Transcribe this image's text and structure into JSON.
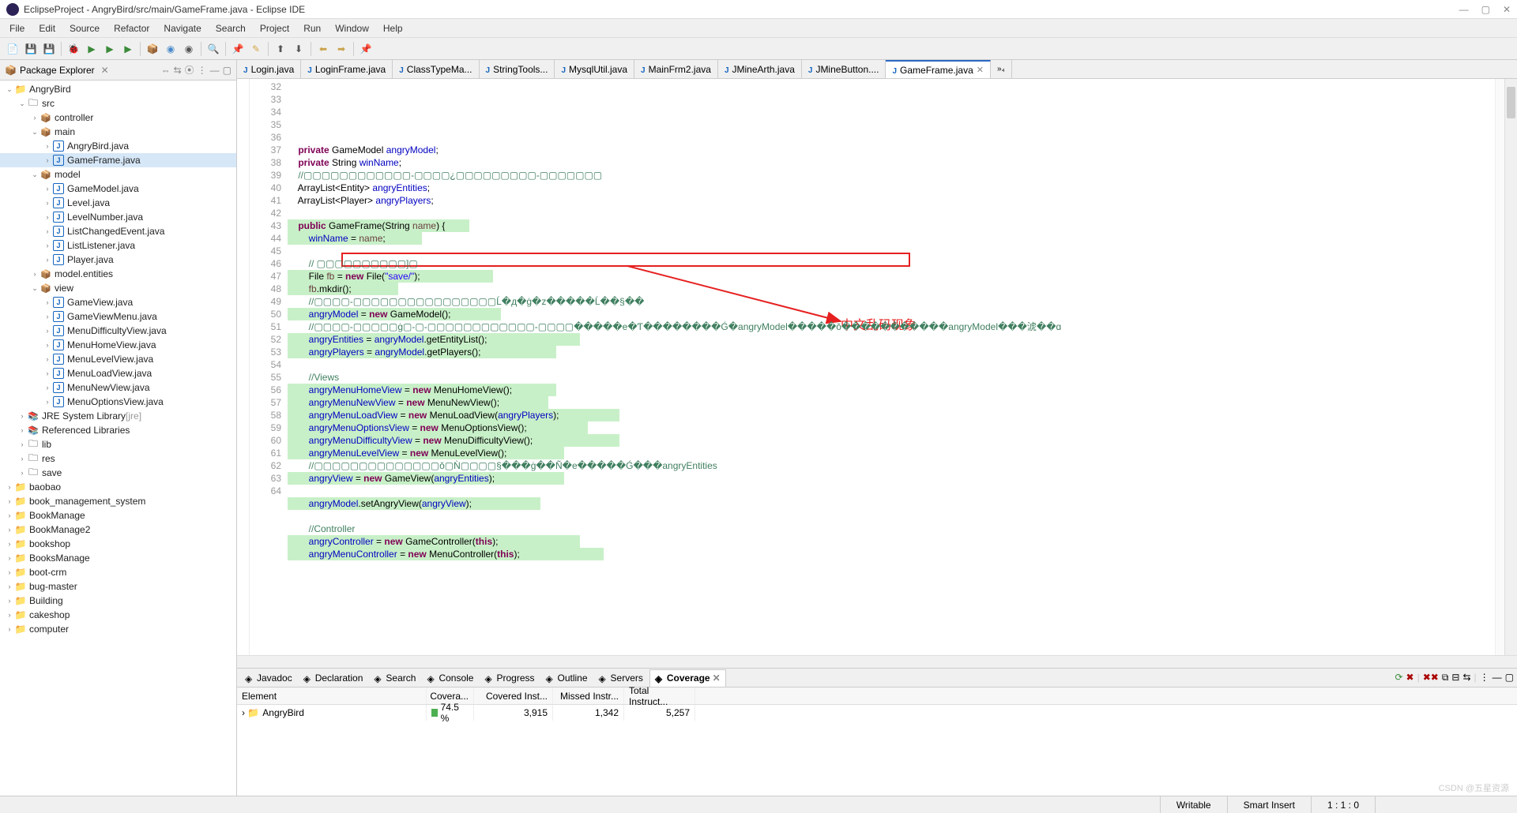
{
  "window": {
    "title": "EclipseProject - AngryBird/src/main/GameFrame.java - Eclipse IDE"
  },
  "menus": [
    "File",
    "Edit",
    "Source",
    "Refactor",
    "Navigate",
    "Search",
    "Project",
    "Run",
    "Window",
    "Help"
  ],
  "package_explorer": {
    "title": "Package Explorer",
    "tree": [
      {
        "d": 0,
        "t": "v",
        "ic": "proj",
        "l": "AngryBird"
      },
      {
        "d": 1,
        "t": "v",
        "ic": "fold",
        "l": "src"
      },
      {
        "d": 2,
        "t": ">",
        "ic": "pkg",
        "l": "controller"
      },
      {
        "d": 2,
        "t": "v",
        "ic": "pkg",
        "l": "main"
      },
      {
        "d": 3,
        "t": ">",
        "ic": "java",
        "l": "AngryBird.java"
      },
      {
        "d": 3,
        "t": ">",
        "ic": "java",
        "l": "GameFrame.java",
        "sel": true
      },
      {
        "d": 2,
        "t": "v",
        "ic": "pkg",
        "l": "model"
      },
      {
        "d": 3,
        "t": ">",
        "ic": "java",
        "l": "GameModel.java"
      },
      {
        "d": 3,
        "t": ">",
        "ic": "java",
        "l": "Level.java"
      },
      {
        "d": 3,
        "t": ">",
        "ic": "java",
        "l": "LevelNumber.java"
      },
      {
        "d": 3,
        "t": ">",
        "ic": "java",
        "l": "ListChangedEvent.java"
      },
      {
        "d": 3,
        "t": ">",
        "ic": "java",
        "l": "ListListener.java"
      },
      {
        "d": 3,
        "t": ">",
        "ic": "java",
        "l": "Player.java"
      },
      {
        "d": 2,
        "t": ">",
        "ic": "pkg",
        "l": "model.entities"
      },
      {
        "d": 2,
        "t": "v",
        "ic": "pkg",
        "l": "view"
      },
      {
        "d": 3,
        "t": ">",
        "ic": "java",
        "l": "GameView.java"
      },
      {
        "d": 3,
        "t": ">",
        "ic": "java",
        "l": "GameViewMenu.java"
      },
      {
        "d": 3,
        "t": ">",
        "ic": "java",
        "l": "MenuDifficultyView.java"
      },
      {
        "d": 3,
        "t": ">",
        "ic": "java",
        "l": "MenuHomeView.java"
      },
      {
        "d": 3,
        "t": ">",
        "ic": "java",
        "l": "MenuLevelView.java"
      },
      {
        "d": 3,
        "t": ">",
        "ic": "java",
        "l": "MenuLoadView.java"
      },
      {
        "d": 3,
        "t": ">",
        "ic": "java",
        "l": "MenuNewView.java"
      },
      {
        "d": 3,
        "t": ">",
        "ic": "java",
        "l": "MenuOptionsView.java"
      },
      {
        "d": 1,
        "t": ">",
        "ic": "lib",
        "l": "JRE System Library",
        "suffix": "[jre]"
      },
      {
        "d": 1,
        "t": ">",
        "ic": "lib",
        "l": "Referenced Libraries"
      },
      {
        "d": 1,
        "t": ">",
        "ic": "fold",
        "l": "lib"
      },
      {
        "d": 1,
        "t": ">",
        "ic": "fold",
        "l": "res"
      },
      {
        "d": 1,
        "t": ">",
        "ic": "fold",
        "l": "save"
      },
      {
        "d": 0,
        "t": ">",
        "ic": "proj",
        "l": "baobao"
      },
      {
        "d": 0,
        "t": ">",
        "ic": "proj",
        "l": "book_management_system"
      },
      {
        "d": 0,
        "t": ">",
        "ic": "proj",
        "l": "BookManage"
      },
      {
        "d": 0,
        "t": ">",
        "ic": "proj",
        "l": "BookManage2"
      },
      {
        "d": 0,
        "t": ">",
        "ic": "proj",
        "l": "bookshop"
      },
      {
        "d": 0,
        "t": ">",
        "ic": "proj",
        "l": "BooksManage"
      },
      {
        "d": 0,
        "t": ">",
        "ic": "proj",
        "l": "boot-crm"
      },
      {
        "d": 0,
        "t": ">",
        "ic": "proj",
        "l": "bug-master"
      },
      {
        "d": 0,
        "t": ">",
        "ic": "proj",
        "l": "Building"
      },
      {
        "d": 0,
        "t": ">",
        "ic": "proj",
        "l": "cakeshop"
      },
      {
        "d": 0,
        "t": ">",
        "ic": "proj",
        "l": "computer"
      }
    ]
  },
  "editor": {
    "tabs": [
      {
        "l": "Login.java"
      },
      {
        "l": "LoginFrame.java"
      },
      {
        "l": "ClassTypeMa..."
      },
      {
        "l": "StringTools..."
      },
      {
        "l": "MysqlUtil.java"
      },
      {
        "l": "MainFrm2.java"
      },
      {
        "l": "JMineArth.java"
      },
      {
        "l": "JMineButton...."
      },
      {
        "l": "GameFrame.java",
        "active": true
      }
    ],
    "first_line": 32,
    "lines": [
      {
        "hl": false,
        "html": "    <span class='kw'>private</span> GameModel <span class='fld'>angryModel</span>;"
      },
      {
        "hl": false,
        "html": "    <span class='kw'>private</span> String <span class='fld'>winName</span>;"
      },
      {
        "hl": false,
        "html": "    <span class='cmt'>//▢▢▢▢▢▢▢▢▢▢▢▢-▢▢▢▢¿▢▢▢▢▢▢▢▢▢-▢▢▢▢▢▢▢</span>"
      },
      {
        "hl": false,
        "html": "    ArrayList&lt;Entity&gt; <span class='fld'>angryEntities</span>;"
      },
      {
        "hl": false,
        "html": "    ArrayList&lt;Player&gt; <span class='fld'>angryPlayers</span>;"
      },
      {
        "hl": false,
        "html": ""
      },
      {
        "hl": true,
        "hlw": 230,
        "html": "    <span class='kw'>public</span> GameFrame(String <span class='var'>name</span>) {"
      },
      {
        "hl": true,
        "hlw": 170,
        "html": "        <span class='fld'>winName</span> = <span class='var'>name</span>;"
      },
      {
        "hl": false,
        "html": ""
      },
      {
        "hl": false,
        "html": "        <span class='cmt'>// ▢▢▢▢▢▢▢▢▢▢]▢</span>"
      },
      {
        "hl": true,
        "hlw": 260,
        "html": "        File <span class='var'>fb</span> = <span class='kw'>new</span> File(<span class='str'>\"save/\"</span>);"
      },
      {
        "hl": true,
        "hlw": 140,
        "html": "        <span class='var'>fb</span>.mkdir();"
      },
      {
        "hl": false,
        "html": "        <span class='cmt'>//▢▢▢▢-▢▢▢▢▢▢▢▢▢▢▢▢▢▢▢▢Ĺ�д�ġ�z�����Ĺ��§��</span>"
      },
      {
        "hl": true,
        "hlw": 270,
        "html": "        <span class='fld'>angryModel</span> = <span class='kw'>new</span> GameModel();"
      },
      {
        "hl": false,
        "html": "        <span class='cmt'>//▢▢▢▢-▢▢▢▢▢ġ▢-▢-▢▢▢▢▢▢▢▢▢▢▢▢-▢▢▢▢�����e�Ƭ��������Ǵ�angryModel�����ǒ�����������angryModel���淲��ɑ</span>"
      },
      {
        "hl": true,
        "hlw": 370,
        "html": "        <span class='fld'>angryEntities</span> = <span class='fld'>angryModel</span>.getEntityList();"
      },
      {
        "hl": true,
        "hlw": 340,
        "html": "        <span class='fld'>angryPlayers</span> = <span class='fld'>angryModel</span>.getPlayers();"
      },
      {
        "hl": false,
        "html": ""
      },
      {
        "hl": false,
        "html": "        <span class='cmt'>//Views</span>"
      },
      {
        "hl": true,
        "hlw": 340,
        "html": "        <span class='fld'>angryMenuHomeView</span> = <span class='kw'>new</span> MenuHomeView();"
      },
      {
        "hl": true,
        "hlw": 330,
        "html": "        <span class='fld'>angryMenuNewView</span> = <span class='kw'>new</span> MenuNewView();"
      },
      {
        "hl": true,
        "hlw": 420,
        "html": "        <span class='fld'>angryMenuLoadView</span> = <span class='kw'>new</span> MenuLoadView(<span class='fld'>angryPlayers</span>);"
      },
      {
        "hl": true,
        "hlw": 380,
        "html": "        <span class='fld'>angryMenuOptionsView</span> = <span class='kw'>new</span> MenuOptionsView();"
      },
      {
        "hl": true,
        "hlw": 420,
        "html": "        <span class='fld'>angryMenuDifficultyView</span> = <span class='kw'>new</span> MenuDifficultyView();"
      },
      {
        "hl": true,
        "hlw": 350,
        "html": "        <span class='fld'>angryMenuLevelView</span> = <span class='kw'>new</span> MenuLevelView();"
      },
      {
        "hl": false,
        "html": "        <span class='cmt'>//▢▢▢▢▢▢▢▢▢▢▢▢▢▢ǒ▢Ǹ▢▢▢▢§���ġ��Ñ�e�����Ǵ���angryEntities</span>"
      },
      {
        "hl": true,
        "hlw": 350,
        "html": "        <span class='fld'>angryView</span> = <span class='kw'>new</span> GameView(<span class='fld'>angryEntities</span>);"
      },
      {
        "hl": false,
        "html": ""
      },
      {
        "hl": true,
        "hlw": 320,
        "html": "        <span class='fld'>angryModel</span>.setAngryView(<span class='fld'>angryView</span>);"
      },
      {
        "hl": false,
        "html": ""
      },
      {
        "hl": false,
        "html": "        <span class='cmt'>//Controller</span>"
      },
      {
        "hl": true,
        "hlw": 370,
        "html": "        <span class='fld'>angryController</span> = <span class='kw'>new</span> GameController(<span class='kw'>this</span>);"
      },
      {
        "hl": true,
        "hlw": 400,
        "html": "        <span class='fld'>angryMenuController</span> = <span class='kw'>new</span> MenuController(<span class='kw'>this</span>);"
      }
    ]
  },
  "callout": {
    "text": "中文乱码现象"
  },
  "bottom_panel": {
    "tabs": [
      "Javadoc",
      "Declaration",
      "Search",
      "Console",
      "Progress",
      "Outline",
      "Servers",
      "Coverage"
    ],
    "active_tab": "Coverage",
    "columns": [
      "Element",
      "Covera...",
      "Covered Inst...",
      "Missed Instr...",
      "Total Instruct..."
    ],
    "rows": [
      {
        "el": "AngryBird",
        "cov": "74.5 %",
        "ci": "3,915",
        "mi": "1,342",
        "ti": "5,257"
      }
    ]
  },
  "status": {
    "writable": "Writable",
    "insert": "Smart Insert",
    "pos": "1 : 1 : 0"
  },
  "watermark": "CSDN @五星资源"
}
